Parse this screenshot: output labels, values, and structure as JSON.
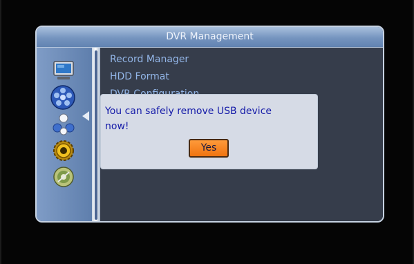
{
  "window": {
    "title": "DVR Management"
  },
  "sidebar": {
    "items": [
      {
        "icon": "monitor-icon"
      },
      {
        "icon": "film-reel-icon",
        "selected": true
      },
      {
        "icon": "balls-icon"
      },
      {
        "icon": "gear-icon"
      },
      {
        "icon": "disc-icon"
      }
    ]
  },
  "menu": {
    "items": [
      "Record Manager",
      "HDD Format",
      "DVR Configuration"
    ]
  },
  "dialog": {
    "message_line1": "You can safely remove USB device",
    "message_line2": "now!",
    "yes_label": "Yes"
  },
  "colors": {
    "title_bar": "#7594bf",
    "menu_text": "#93b6e8",
    "dialog_text": "#141aa8",
    "button": "#f07410"
  }
}
